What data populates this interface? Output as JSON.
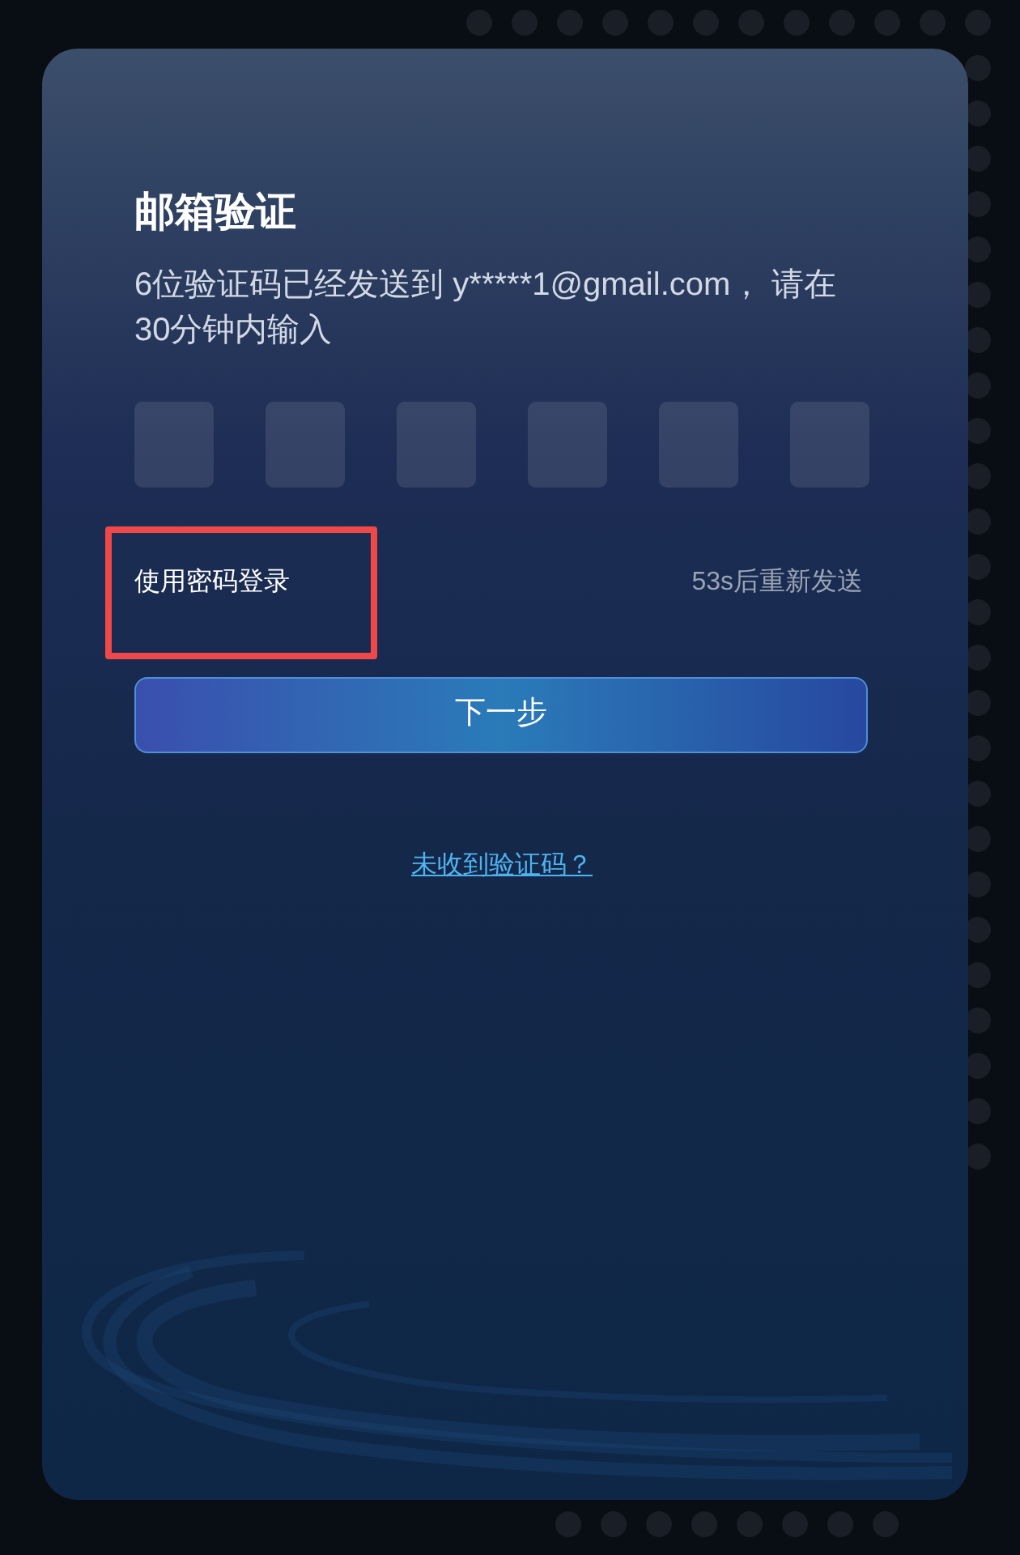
{
  "title": "邮箱验证",
  "description": "6位验证码已经发送到 y*****1@gmail.com， 请在30分钟内输入",
  "code_fields": [
    {
      "focused": false
    },
    {
      "focused": false
    },
    {
      "focused": false
    },
    {
      "focused": false
    },
    {
      "focused": false
    },
    {
      "focused": false
    }
  ],
  "password_login": {
    "label": "使用密码登录",
    "highlighted": true
  },
  "resend": "53s后重新发送",
  "next_button": "下一步",
  "help_link": "未收到验证码？"
}
